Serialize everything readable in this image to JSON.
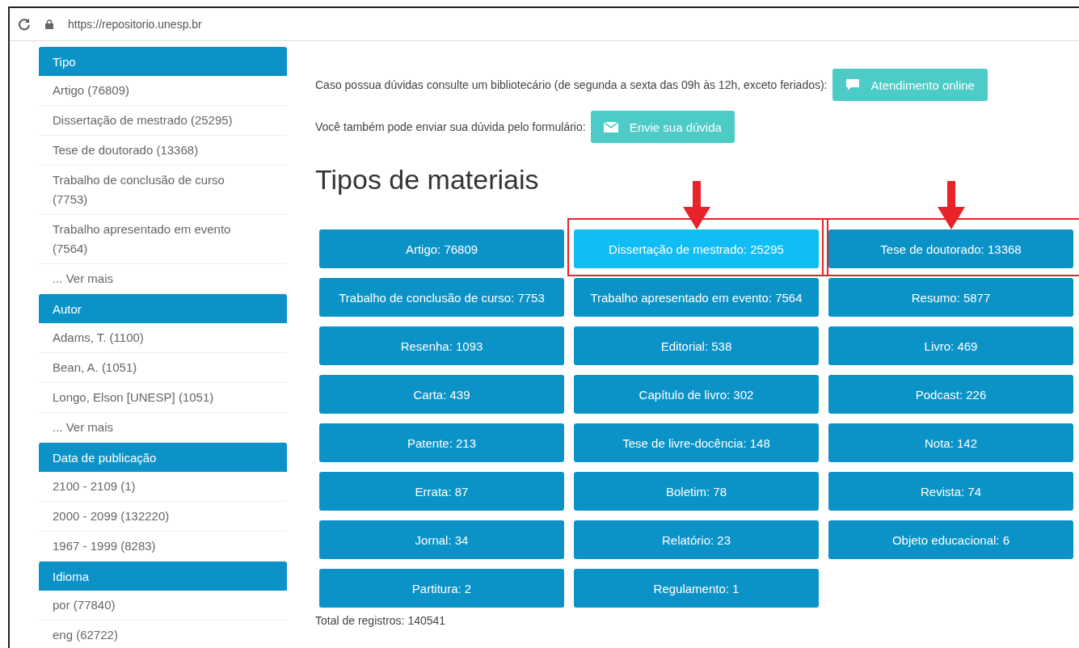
{
  "browser": {
    "url": "https://repositorio.unesp.br"
  },
  "sidebar": [
    {
      "title": "Tipo",
      "items": [
        "Artigo (76809)",
        "Dissertação de mestrado (25295)",
        "Tese de doutorado (13368)",
        "Trabalho de conclusão de curso (7753)",
        "Trabalho apresentado em evento (7564)"
      ],
      "more": "... Ver mais"
    },
    {
      "title": "Autor",
      "items": [
        "Adams, T. (1100)",
        "Bean, A. (1051)",
        "Longo, Elson [UNESP] (1051)"
      ],
      "more": "... Ver mais"
    },
    {
      "title": "Data de publicação",
      "items": [
        "2100 - 2109 (1)",
        "2000 - 2099 (132220)",
        "1967 - 1999 (8283)"
      ]
    },
    {
      "title": "Idioma",
      "items": [
        "por (77840)",
        "eng (62722)"
      ]
    }
  ],
  "help": [
    {
      "text": "Caso possua dúvidas consulte um bibliotecário (de segunda a sexta das 09h às 12h, exceto feriados):",
      "button": "Atendimento online",
      "kind": "chat"
    },
    {
      "text": "Você também pode enviar sua dúvida pelo formulário:",
      "button": "Envie sua dúvida",
      "kind": "mail"
    }
  ],
  "heading": "Tipos de materiais",
  "materials": [
    {
      "label": "Artigo: 76809",
      "active": false,
      "highlighted": false
    },
    {
      "label": "Dissertação de mestrado: 25295",
      "active": true,
      "highlighted": true
    },
    {
      "label": "Tese de doutorado: 13368",
      "active": false,
      "highlighted": true
    },
    {
      "label": "Trabalho de conclusão de curso: 7753",
      "active": false,
      "highlighted": false
    },
    {
      "label": "Trabalho apresentado em evento: 7564",
      "active": false,
      "highlighted": false
    },
    {
      "label": "Resumo: 5877",
      "active": false,
      "highlighted": false
    },
    {
      "label": "Resenha: 1093",
      "active": false,
      "highlighted": false
    },
    {
      "label": "Editorial: 538",
      "active": false,
      "highlighted": false
    },
    {
      "label": "Livro: 469",
      "active": false,
      "highlighted": false
    },
    {
      "label": "Carta: 439",
      "active": false,
      "highlighted": false
    },
    {
      "label": "Capítulo de livro: 302",
      "active": false,
      "highlighted": false
    },
    {
      "label": "Podcast: 226",
      "active": false,
      "highlighted": false
    },
    {
      "label": "Patente: 213",
      "active": false,
      "highlighted": false
    },
    {
      "label": "Tese de livre-docência: 148",
      "active": false,
      "highlighted": false
    },
    {
      "label": "Nota: 142",
      "active": false,
      "highlighted": false
    },
    {
      "label": "Errata: 87",
      "active": false,
      "highlighted": false
    },
    {
      "label": "Boletim: 78",
      "active": false,
      "highlighted": false
    },
    {
      "label": "Revista: 74",
      "active": false,
      "highlighted": false
    },
    {
      "label": "Jornal: 34",
      "active": false,
      "highlighted": false
    },
    {
      "label": "Relatório: 23",
      "active": false,
      "highlighted": false
    },
    {
      "label": "Objeto educacional: 6",
      "active": false,
      "highlighted": false
    },
    {
      "label": "Partitura: 2",
      "active": false,
      "highlighted": false
    },
    {
      "label": "Regulamento: 1",
      "active": false,
      "highlighted": false
    }
  ],
  "total": "Total de registros: 140541"
}
